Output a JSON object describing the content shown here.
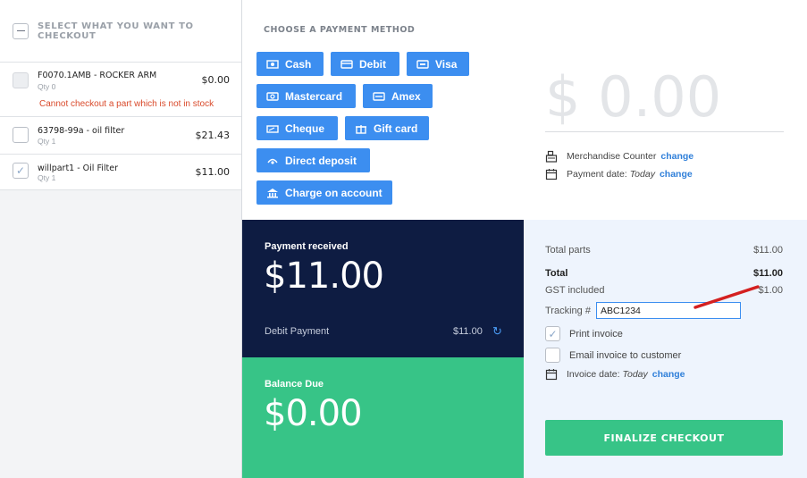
{
  "left_panel": {
    "header": "SELECT WHAT YOU WANT TO CHECKOUT",
    "items": [
      {
        "name": "F0070.1AMB - ROCKER ARM",
        "qty": "Qty 0",
        "price": "$0.00",
        "error": "Cannot checkout a part which is not in stock",
        "checked": false,
        "disabled": true
      },
      {
        "name": "63798-99a - oil filter",
        "qty": "Qty 1",
        "price": "$21.43",
        "checked": false,
        "disabled": false
      },
      {
        "name": "willpart1 - Oil Filter",
        "qty": "Qty 1",
        "price": "$11.00",
        "checked": true,
        "disabled": false
      }
    ]
  },
  "payment": {
    "title": "CHOOSE A PAYMENT METHOD",
    "buttons": {
      "cash": "Cash",
      "debit": "Debit",
      "visa": "Visa",
      "mastercard": "Mastercard",
      "amex": "Amex",
      "cheque": "Cheque",
      "gift_card": "Gift card",
      "direct_deposit": "Direct deposit",
      "charge_on_account": "Charge on account"
    },
    "amount": "$ 0.00",
    "counter_label": "Merchandise Counter",
    "change": "change",
    "payment_date_label": "Payment date:",
    "payment_date_value": "Today"
  },
  "received": {
    "label": "Payment received",
    "amount": "$11.00",
    "line_label": "Debit Payment",
    "line_value": "$11.00"
  },
  "balance": {
    "label": "Balance Due",
    "amount": "$0.00"
  },
  "summary": {
    "total_parts_label": "Total parts",
    "total_parts_value": "$11.00",
    "total_label": "Total",
    "total_value": "$11.00",
    "gst_label": "GST included",
    "gst_value": "$1.00",
    "tracking_label": "Tracking #",
    "tracking_value": "ABC1234",
    "print_invoice": "Print invoice",
    "email_invoice": "Email invoice to customer",
    "invoice_date_label": "Invoice date:",
    "invoice_date_value": "Today",
    "change": "change",
    "finalize": "FINALIZE CHECKOUT"
  },
  "colors": {
    "primary_blue": "#3c8ef0",
    "navy": "#0e1c42",
    "green": "#37c487",
    "error": "#d94a2b",
    "annotation": "#d42020"
  }
}
